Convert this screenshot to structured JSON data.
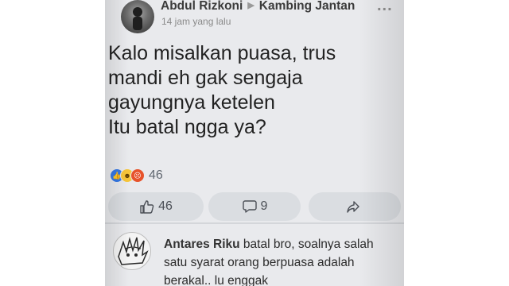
{
  "post": {
    "author": "Abdul Rizkoni",
    "group": "Kambing Jantan",
    "more": "...",
    "time": "14 jam yang lalu",
    "text_lines": [
      "Kalo misalkan puasa, trus",
      "mandi eh gak sengaja",
      "gayungnya ketelen",
      "Itu batal ngga ya?"
    ],
    "reaction_count": "46",
    "reaction_icons": [
      "like-icon",
      "haha-icon",
      "angry-icon"
    ]
  },
  "actions": {
    "like_count": "46",
    "comment_count": "9"
  },
  "comment": {
    "author": "Antares Riku",
    "lines": [
      " batal bro, soalnya salah",
      "satu syarat orang berpuasa adalah",
      "berakal.. lu enggak"
    ]
  }
}
